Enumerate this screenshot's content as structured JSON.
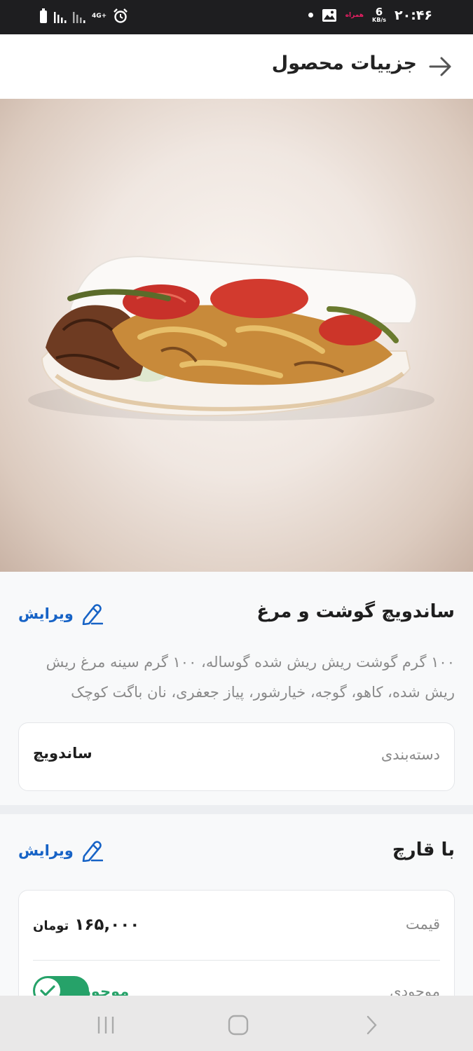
{
  "status_bar": {
    "time": "۲۰:۴۶",
    "speed_value": "6",
    "speed_unit": "KB/s",
    "carrier": "همراه",
    "network": "4G+"
  },
  "header": {
    "title": "جزییات محصول",
    "back_icon": "arrow-right-icon"
  },
  "product": {
    "image": "sandwich-photo",
    "title": "ساندویچ گوشت و مرغ",
    "edit_label": "ویرایش",
    "description": "۱۰۰ گرم گوشت ریش ریش شده گوساله، ۱۰۰ گرم سینه مرغ ریش ریش شده، کاهو، گوجه، خیارشور، پیاز جعفری، نان باگت کوچک",
    "category_label": "دسته‌بندی",
    "category_value": "ساندویچ"
  },
  "variant": {
    "title": "با قارچ",
    "edit_label": "ویرایش",
    "price_label": "قیمت",
    "price_value": "۱۶۵,۰۰۰",
    "price_currency": "تومان",
    "stock_label": "موجودی",
    "stock_status": "موجود",
    "in_stock": true
  },
  "colors": {
    "accent": "#1763c6",
    "success": "#26a269",
    "status_bar": "#1e1e20"
  }
}
